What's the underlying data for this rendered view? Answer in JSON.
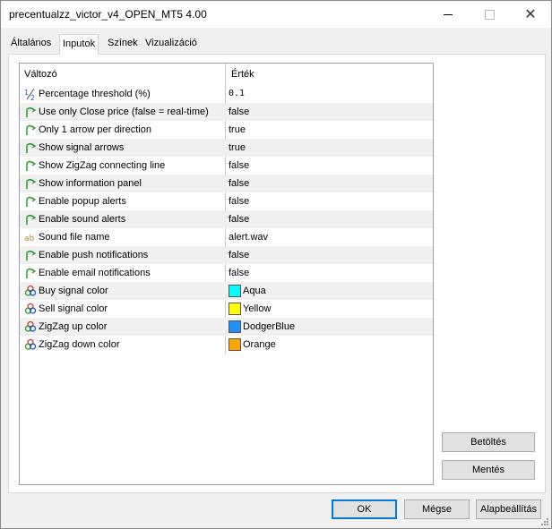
{
  "window": {
    "title": "precentualzz_victor_v4_OPEN_MT5 4.00"
  },
  "tabs": [
    {
      "label": "Általános"
    },
    {
      "label": "Inputok"
    },
    {
      "label": "Színek"
    },
    {
      "label": "Vizualizáció"
    }
  ],
  "active_tab": "Inputok",
  "table": {
    "col_name": "Változó",
    "col_value": "Érték",
    "rows": [
      {
        "icon": "fraction-icon",
        "name": "Percentage threshold (%)",
        "value": "0.1"
      },
      {
        "icon": "boolean-icon",
        "name": "Use only Close price (false = real-time)",
        "value": "false"
      },
      {
        "icon": "boolean-icon",
        "name": "Only 1 arrow per direction",
        "value": "true"
      },
      {
        "icon": "boolean-icon",
        "name": "Show signal arrows",
        "value": "true"
      },
      {
        "icon": "boolean-icon",
        "name": "Show ZigZag connecting line",
        "value": "false"
      },
      {
        "icon": "boolean-icon",
        "name": "Show information panel",
        "value": "false"
      },
      {
        "icon": "boolean-icon",
        "name": "Enable popup alerts",
        "value": "false"
      },
      {
        "icon": "boolean-icon",
        "name": "Enable sound alerts",
        "value": "false"
      },
      {
        "icon": "string-icon",
        "name": "Sound file name",
        "value": "alert.wav"
      },
      {
        "icon": "boolean-icon",
        "name": "Enable push notifications",
        "value": "false"
      },
      {
        "icon": "boolean-icon",
        "name": "Enable email notifications",
        "value": "false"
      },
      {
        "icon": "color-icon",
        "name": "Buy signal color",
        "value": "Aqua",
        "color": "#00ffff"
      },
      {
        "icon": "color-icon",
        "name": "Sell signal color",
        "value": "Yellow",
        "color": "#ffff00"
      },
      {
        "icon": "color-icon",
        "name": "ZigZag up color",
        "value": "DodgerBlue",
        "color": "#1e90ff"
      },
      {
        "icon": "color-icon",
        "name": "ZigZag down color",
        "value": "Orange",
        "color": "#ffa500"
      }
    ]
  },
  "side_buttons": {
    "load": "Betöltés",
    "save": "Mentés"
  },
  "footer": {
    "ok": "OK",
    "cancel": "Mégse",
    "defaults": "Alapbeállítás"
  }
}
